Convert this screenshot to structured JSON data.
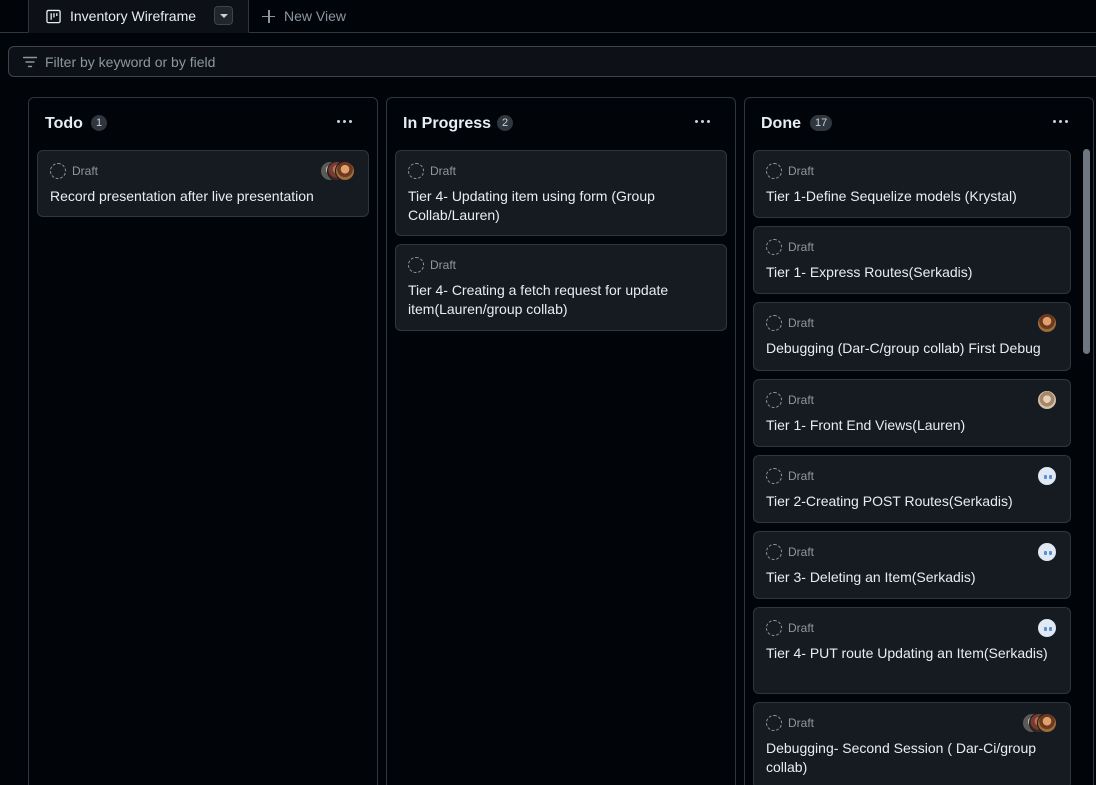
{
  "tabs": {
    "active_label": "Inventory Wireframe",
    "new_view_label": "New View"
  },
  "filter": {
    "placeholder": "Filter by keyword or by field"
  },
  "columns": [
    {
      "title": "Todo",
      "count": "1",
      "cards": [
        {
          "status": "Draft",
          "title": "Record presentation after live presentation",
          "assignees": [
            "gray-avatar",
            "brown-avatar",
            "beard-avatar"
          ]
        }
      ]
    },
    {
      "title": "In Progress",
      "count": "2",
      "cards": [
        {
          "status": "Draft",
          "title": "Tier 4- Updating item using form (Group Collab/Lauren)",
          "assignees": []
        },
        {
          "status": "Draft",
          "title": "Tier 4- Creating a fetch request for update item(Lauren/group collab)",
          "assignees": []
        }
      ]
    },
    {
      "title": "Done",
      "count": "17",
      "cards": [
        {
          "status": "Draft",
          "title": "Tier 1-Define Sequelize models (Krystal)",
          "assignees": []
        },
        {
          "status": "Draft",
          "title": "Tier 1- Express Routes(Serkadis)",
          "assignees": []
        },
        {
          "status": "Draft",
          "title": "Debugging (Dar-C/group collab) First Debug",
          "assignees": [
            "beard-avatar"
          ]
        },
        {
          "status": "Draft",
          "title": "Tier 1- Front End Views(Lauren)",
          "assignees": [
            "woman-avatar"
          ]
        },
        {
          "status": "Draft",
          "title": "Tier 2-Creating POST Routes(Serkadis)",
          "assignees": [
            "identicon-avatar"
          ]
        },
        {
          "status": "Draft",
          "title": "Tier 3- Deleting an Item(Serkadis)",
          "assignees": [
            "identicon-avatar"
          ]
        },
        {
          "status": "Draft",
          "title": "Tier 4- PUT route Updating an Item(Serkadis)",
          "assignees": [
            "identicon-avatar"
          ]
        },
        {
          "status": "Draft",
          "title": "Debugging- Second Session ( Dar-Ci/group collab)",
          "assignees": [
            "gray-avatar",
            "brown-avatar",
            "beard-avatar"
          ]
        }
      ]
    }
  ],
  "colors": {
    "background": "#010409",
    "card": "#161b22",
    "border": "#30363d",
    "text": "#e6edf3",
    "muted": "#8d96a0"
  }
}
